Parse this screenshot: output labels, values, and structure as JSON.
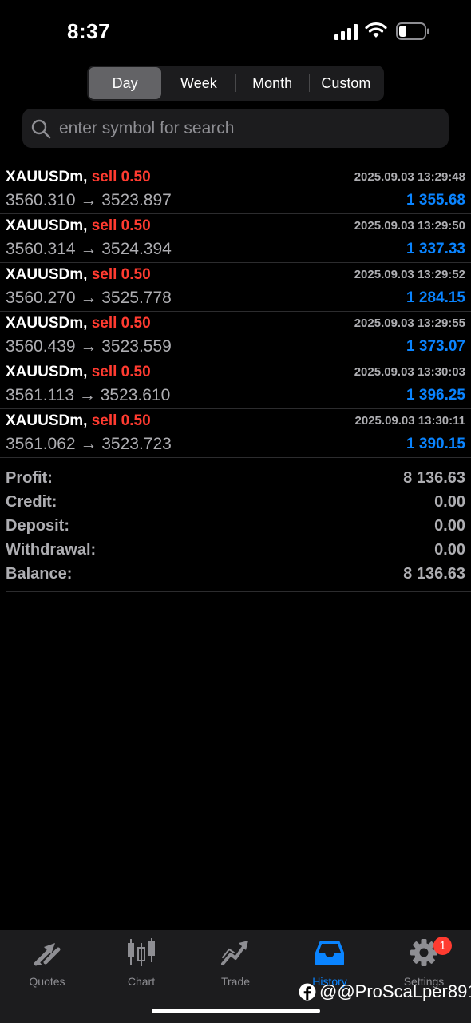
{
  "status_bar": {
    "time": "8:37"
  },
  "period_tabs": [
    {
      "label": "Day",
      "active": true
    },
    {
      "label": "Week",
      "active": false
    },
    {
      "label": "Month",
      "active": false
    },
    {
      "label": "Custom",
      "active": false
    }
  ],
  "search": {
    "placeholder": "enter symbol for search"
  },
  "deals": [
    {
      "symbol": "XAUUSDm,",
      "side": "sell 0.50",
      "prices": "3560.310 → 3523.897",
      "time": "2025.09.03 13:29:48",
      "profit": "1 355.68"
    },
    {
      "symbol": "XAUUSDm,",
      "side": "sell 0.50",
      "prices": "3560.314 → 3524.394",
      "time": "2025.09.03 13:29:50",
      "profit": "1 337.33"
    },
    {
      "symbol": "XAUUSDm,",
      "side": "sell 0.50",
      "prices": "3560.270 → 3525.778",
      "time": "2025.09.03 13:29:52",
      "profit": "1 284.15"
    },
    {
      "symbol": "XAUUSDm,",
      "side": "sell 0.50",
      "prices": "3560.439 → 3523.559",
      "time": "2025.09.03 13:29:55",
      "profit": "1 373.07"
    },
    {
      "symbol": "XAUUSDm,",
      "side": "sell 0.50",
      "prices": "3561.113 → 3523.610",
      "time": "2025.09.03 13:30:03",
      "profit": "1 396.25"
    },
    {
      "symbol": "XAUUSDm,",
      "side": "sell 0.50",
      "prices": "3561.062 → 3523.723",
      "time": "2025.09.03 13:30:11",
      "profit": "1 390.15"
    }
  ],
  "summary": [
    {
      "label": "Profit:",
      "value": "8 136.63"
    },
    {
      "label": "Credit:",
      "value": "0.00"
    },
    {
      "label": "Deposit:",
      "value": "0.00"
    },
    {
      "label": "Withdrawal:",
      "value": "0.00"
    },
    {
      "label": "Balance:",
      "value": "8 136.63"
    }
  ],
  "tabbar": {
    "items": [
      {
        "label": "Quotes",
        "icon": "quotes-arrows-icon"
      },
      {
        "label": "Chart",
        "icon": "candlestick-icon"
      },
      {
        "label": "Trade",
        "icon": "trade-trend-icon"
      },
      {
        "label": "History",
        "icon": "history-inbox-icon",
        "active": true
      },
      {
        "label": "Settings",
        "icon": "gear-icon"
      }
    ],
    "settings_badge": "1"
  },
  "watermark": "@@ProScaLper891",
  "colors": {
    "accent": "#0a84ff",
    "sell": "#ff3b30",
    "muted": "#aeaeb2",
    "tabbar_bg": "#1c1c1e"
  }
}
